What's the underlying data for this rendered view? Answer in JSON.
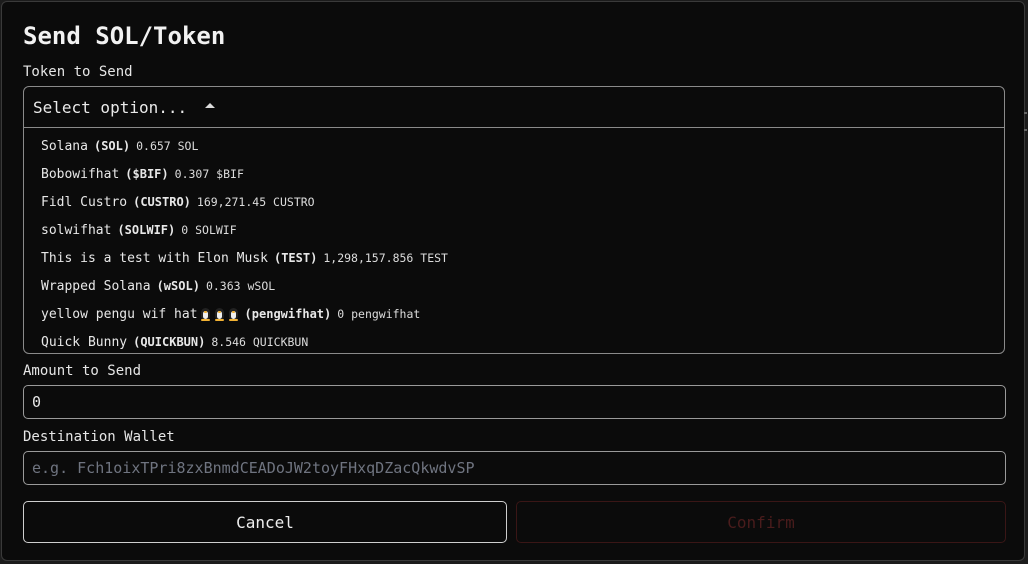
{
  "dialog": {
    "title": "Send SOL/Token",
    "token_label": "Token to Send",
    "select_placeholder": "Select option...",
    "options": [
      {
        "name": "Solana",
        "symbol": "(SOL)",
        "balance": "0.657 SOL"
      },
      {
        "name": "Bobowifhat",
        "symbol": "($BIF)",
        "balance": "0.307 $BIF"
      },
      {
        "name": "Fidl Custro",
        "symbol": "(CUSTRO)",
        "balance": "169,271.45 CUSTRO"
      },
      {
        "name": "solwifhat",
        "symbol": "(SOLWIF)",
        "balance": "0 SOLWIF"
      },
      {
        "name": "This is a test with Elon Musk",
        "symbol": "(TEST)",
        "balance": "1,298,157.856 TEST"
      },
      {
        "name": "Wrapped Solana",
        "symbol": "(wSOL)",
        "balance": "0.363 wSOL"
      },
      {
        "name": "yellow pengu wif hat",
        "symbol": "(pengwifhat)",
        "balance": "0 pengwifhat",
        "emoji": "penguin-icon x3"
      },
      {
        "name": "Quick Bunny",
        "symbol": "(QUICKBUN)",
        "balance": "8.546 QUICKBUN"
      }
    ],
    "amount_label": "Amount to Send",
    "amount_value": "0",
    "destination_label": "Destination Wallet",
    "destination_placeholder": "e.g. Fch1oixTPri8zxBnmdCEADoJW2toyFHxqDZacQkwdvSP",
    "cancel_label": "Cancel",
    "confirm_label": "Confirm"
  },
  "colors": {
    "background": "#0b0b0b",
    "text": "#ececec",
    "border": "#8a8a8a",
    "confirm_disabled": "#4a1c1c"
  }
}
